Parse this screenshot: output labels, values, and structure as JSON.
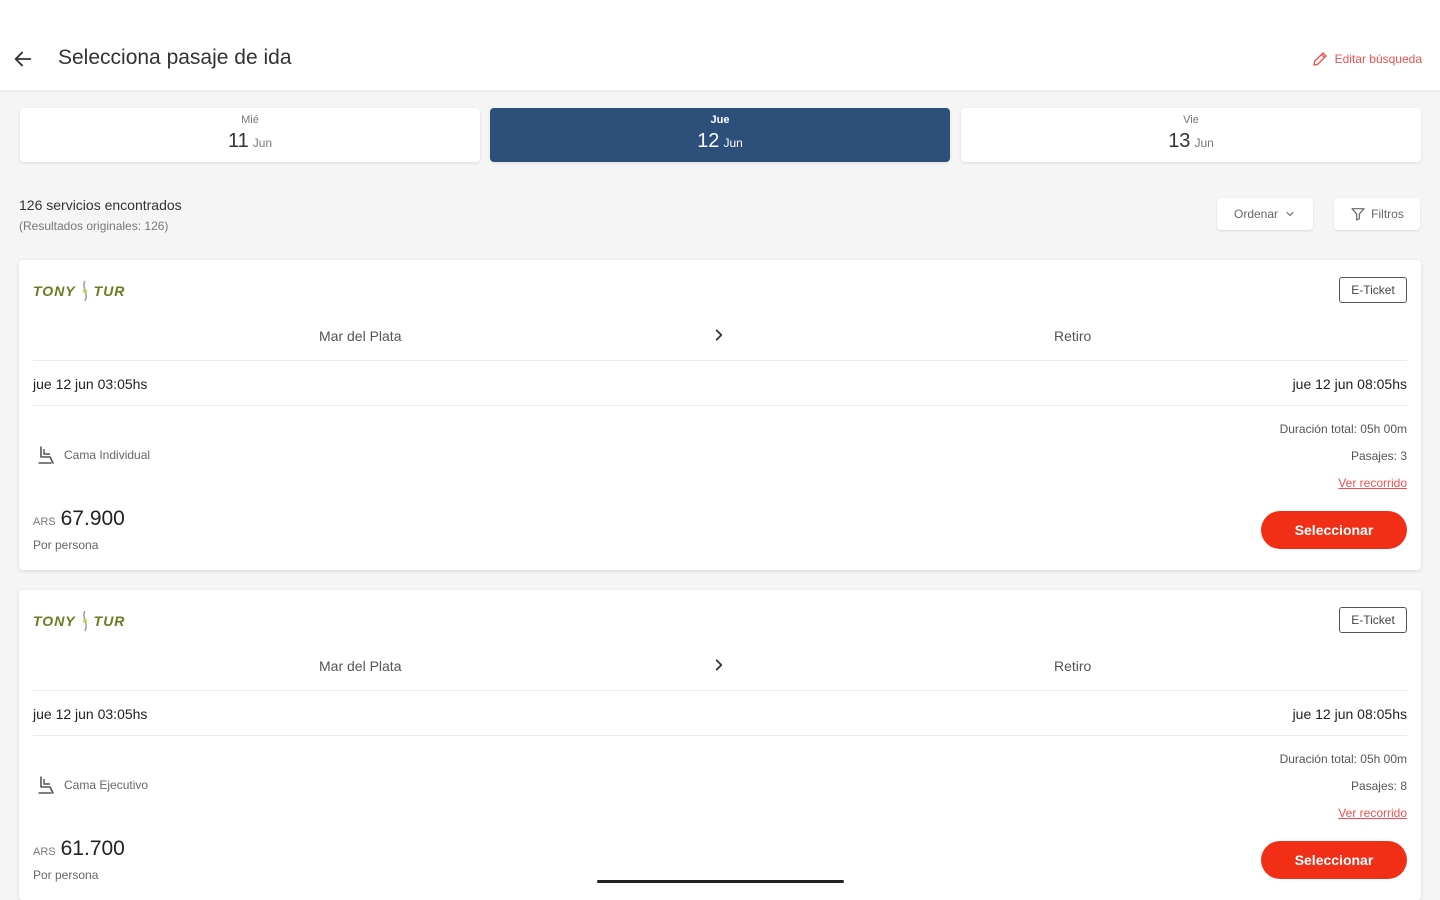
{
  "header": {
    "title": "Selecciona pasaje de ida",
    "edit_label": "Editar búsqueda",
    "accent_color": "#f04e4e"
  },
  "date_tabs": [
    {
      "dow": "Mié",
      "day": "11",
      "month": "Jun",
      "selected": false
    },
    {
      "dow": "Jue",
      "day": "12",
      "month": "Jun",
      "selected": true
    },
    {
      "dow": "Vie",
      "day": "13",
      "month": "Jun",
      "selected": false
    }
  ],
  "results": {
    "count_label": "126 servicios encontrados",
    "original_label": "(Resultados originales: 126)",
    "sort_label": "Ordenar",
    "filter_label": "Filtros"
  },
  "trips": [
    {
      "company": "TONY TUR",
      "ticket_type": "E-Ticket",
      "origin": "Mar del Plata",
      "destination": "Retiro",
      "departure": "jue 12 jun 03:05hs",
      "arrival": "jue 12 jun 08:05hs",
      "seat_type": "Cama Individual",
      "duration": "Duración total: 05h 00m",
      "passages": "Pasajes: 3",
      "route_link": "Ver recorrido",
      "currency": "ARS",
      "price": "67.900",
      "per_person": "Por persona",
      "select_label": "Seleccionar"
    },
    {
      "company": "TONY TUR",
      "ticket_type": "E-Ticket",
      "origin": "Mar del Plata",
      "destination": "Retiro",
      "departure": "jue 12 jun 03:05hs",
      "arrival": "jue 12 jun 08:05hs",
      "seat_type": "Cama Ejecutivo",
      "duration": "Duración total: 05h 00m",
      "passages": "Pasajes: 8",
      "route_link": "Ver recorrido",
      "currency": "ARS",
      "price": "61.700",
      "per_person": "Por persona",
      "select_label": "Seleccionar"
    }
  ],
  "colors": {
    "selected_tab": "#2c5079",
    "primary_button": "#f02f16",
    "link": "#f04e4e"
  }
}
